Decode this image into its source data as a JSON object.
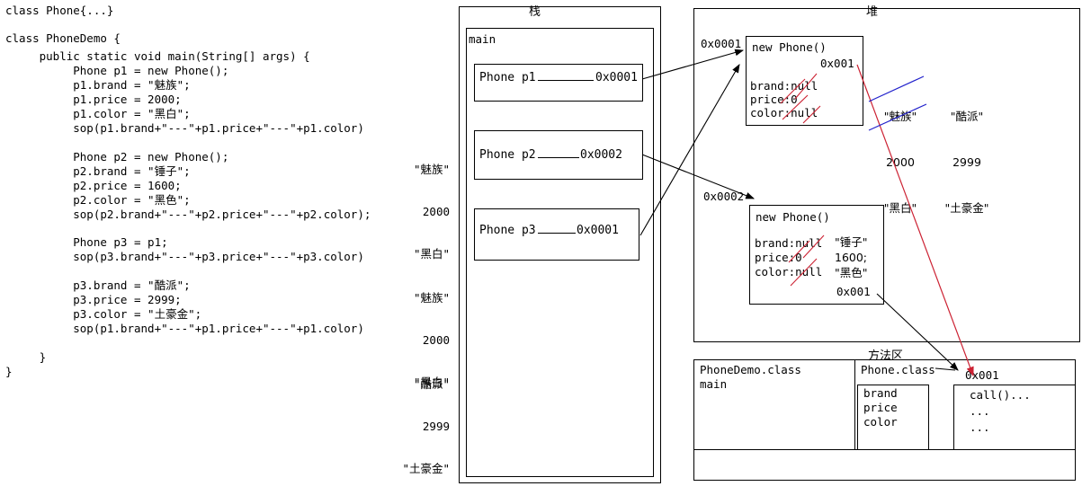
{
  "code": {
    "lines": [
      "class Phone{...}",
      "",
      "class PhoneDemo {",
      "     public static void main(String[] args) {",
      "          Phone p1 = new Phone();",
      "          p1.brand = \"魅族\";",
      "          p1.price = 2000;",
      "          p1.color = \"黑白\";",
      "          sop(p1.brand+\"---\"+p1.price+\"---\"+p1.color)",
      "",
      "          Phone p2 = new Phone();",
      "          p2.brand = \"锤子\";",
      "          p2.price = 1600;",
      "          p2.color = \"黑色\";",
      "          sop(p2.brand+\"---\"+p2.price+\"---\"+p2.color);",
      "",
      "          Phone p3 = p1;",
      "          sop(p3.brand+\"---\"+p3.price+\"---\"+p3.color)",
      "",
      "          p3.brand = \"酷派\";",
      "          p3.price = 2999;",
      "          p3.color = \"土豪金\";",
      "          sop(p1.brand+\"---\"+p1.price+\"---\"+p1.color)",
      "",
      "     }",
      "}"
    ],
    "output_annotations": [
      {
        "id": "out1",
        "lines": [
          "\"魅族\"",
          "2000",
          "\"黑白\""
        ]
      },
      {
        "id": "out2",
        "lines": [
          "\"魅族\"",
          "2000",
          "\"黑白\""
        ]
      },
      {
        "id": "out3",
        "lines": [
          "\"酷派\"",
          "2999",
          "\"土豪金\""
        ]
      }
    ]
  },
  "stack": {
    "title": "栈",
    "frame_label": "main",
    "slots": [
      {
        "name": "Phone p1",
        "address": "0x0001"
      },
      {
        "name": "Phone p2",
        "address": "0x0002"
      },
      {
        "name": "Phone p3",
        "address": "0x0001"
      }
    ]
  },
  "heap": {
    "title": "堆",
    "objects": [
      {
        "address_label": "0x0001",
        "header": "new Phone()",
        "class_ref": "0x001",
        "fields": [
          "brand:null",
          "price:0",
          "color:null"
        ],
        "field_values": [],
        "self_ref": ""
      },
      {
        "address_label": "0x0002",
        "header": "new Phone()",
        "class_ref": "",
        "fields": [
          "brand:null",
          "price:0",
          "color:null"
        ],
        "field_values": [
          "\"锤子\"",
          "1600;",
          "\"黑色\""
        ],
        "self_ref": "0x001"
      }
    ],
    "notes": [
      {
        "id": "note-old",
        "lines": [
          "\"魅族\"",
          "2000",
          "\"黑白\""
        ],
        "struck": true,
        "color": "#2222cc"
      },
      {
        "id": "note-new",
        "lines": [
          "\"酷派\"",
          "2999",
          "\"土豪金\""
        ],
        "struck": false,
        "color": "#000000"
      }
    ]
  },
  "method_area": {
    "title": "方法区",
    "phonedemo_class": "PhoneDemo.class",
    "phonedemo_member": "main",
    "phone_class": "Phone.class",
    "phone_class_addr": "0x001",
    "fields": [
      "brand",
      "price",
      "color"
    ],
    "methods": [
      "call()...",
      "...",
      "..."
    ]
  },
  "colors": {
    "ink": "#000000",
    "red_mark": "#cc2233",
    "blue_mark": "#2222cc"
  }
}
